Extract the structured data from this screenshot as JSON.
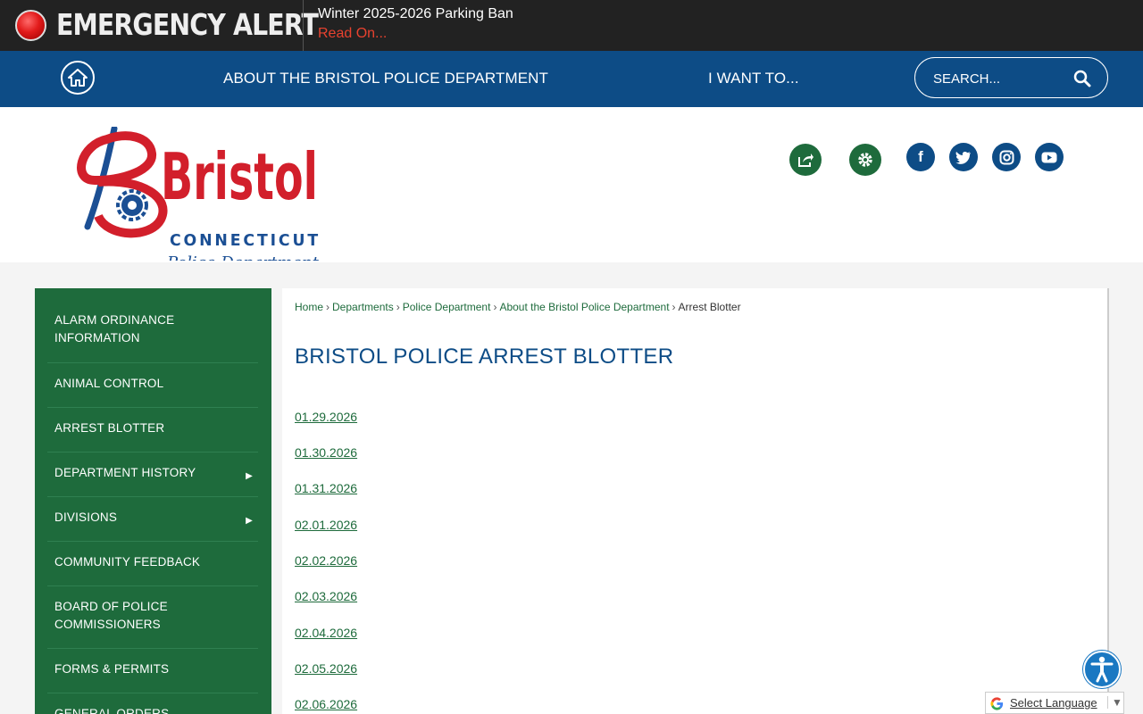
{
  "alert": {
    "title": "EMERGENCY ALERT",
    "message": "Winter 2025-2026 Parking Ban",
    "read_on": "Read On..."
  },
  "nav": {
    "items": [
      {
        "label": "ABOUT THE BRISTOL POLICE DEPARTMENT"
      },
      {
        "label": "I WANT TO..."
      }
    ],
    "search_placeholder": "SEARCH..."
  },
  "logo": {
    "word": "Bristol",
    "state": "CONNECTICUT",
    "dept": "Police Department"
  },
  "social": [
    "share-icon",
    "gear-icon",
    "facebook-icon",
    "twitter-icon",
    "instagram-icon",
    "youtube-icon"
  ],
  "colors": {
    "alert_bg": "#222222",
    "nav_blue": "#0d4c86",
    "sidebar_green": "#1e6b3c",
    "alert_red": "#e8422f",
    "logo_red": "#d21f2b"
  },
  "sidebar": {
    "items": [
      {
        "label": "ALARM ORDINANCE INFORMATION",
        "submenu": false
      },
      {
        "label": "ANIMAL CONTROL",
        "submenu": false
      },
      {
        "label": "ARREST BLOTTER",
        "submenu": false
      },
      {
        "label": "DEPARTMENT HISTORY",
        "submenu": true
      },
      {
        "label": "DIVISIONS",
        "submenu": true
      },
      {
        "label": "COMMUNITY FEEDBACK",
        "submenu": false
      },
      {
        "label": "BOARD OF POLICE COMMISSIONERS",
        "submenu": false
      },
      {
        "label": "FORMS & PERMITS",
        "submenu": false
      },
      {
        "label": "GENERAL ORDERS",
        "submenu": false
      }
    ]
  },
  "breadcrumb": {
    "items": [
      "Home",
      "Departments",
      "Police Department",
      "About the Bristol Police Department"
    ],
    "current": "Arrest Blotter"
  },
  "page": {
    "title": "BRISTOL POLICE ARREST BLOTTER",
    "links": [
      "01.29.2026",
      "01.30.2026",
      "01.31.2026",
      "02.01.2026",
      "02.02.2026",
      "02.03.2026",
      "02.04.2026",
      "02.05.2026",
      "02.06.2026"
    ]
  },
  "translate": {
    "label": "Select Language",
    "caret": "▼"
  }
}
